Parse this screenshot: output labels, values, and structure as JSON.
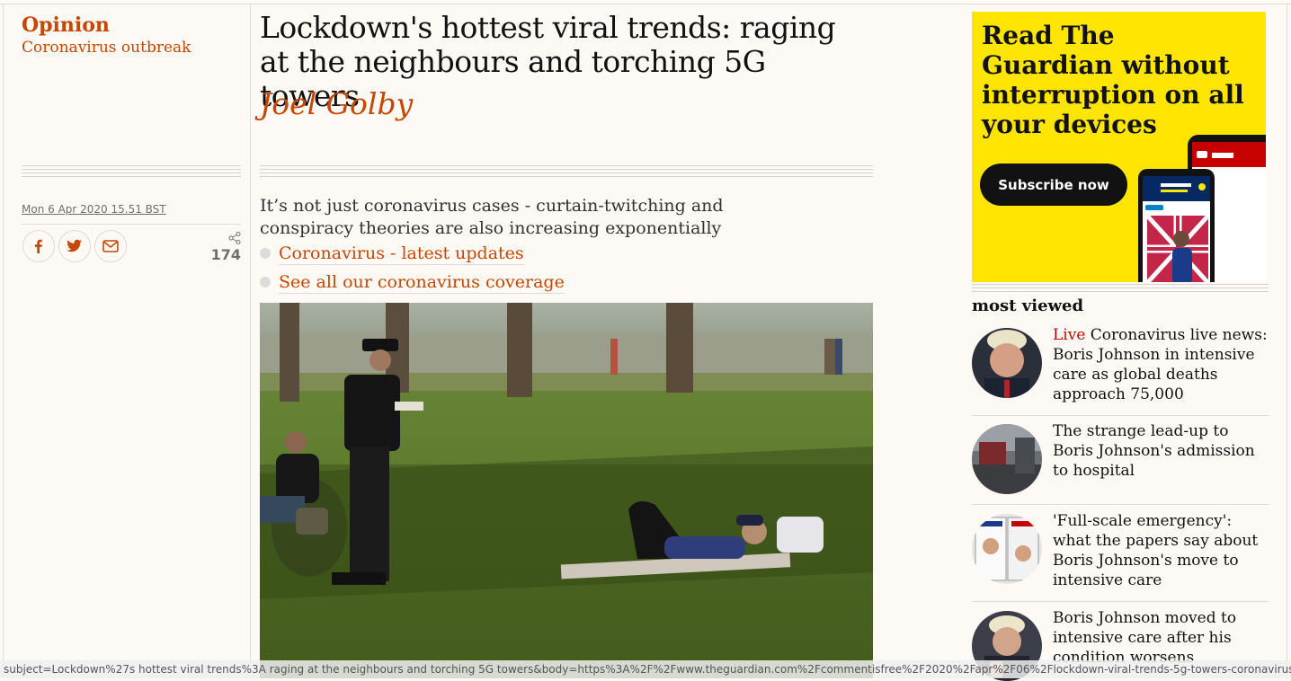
{
  "article": {
    "kicker": "Opinion",
    "series": "Coronavirus outbreak",
    "headline": "Lockdown's hottest viral trends: raging at the neighbours and torching 5G towers",
    "byline": "Joel Golby",
    "dateline": "Mon 6 Apr 2020 15.51 BST",
    "share_count": "174",
    "standfirst": "It’s not just coronavirus cases - curtain-twitching and conspiracy theories are also increasing exponentially",
    "related_links": [
      "Coronavirus - latest updates",
      "See all our coronavirus coverage"
    ]
  },
  "share_icons": [
    "facebook-icon",
    "twitter-icon",
    "email-icon",
    "share-icon"
  ],
  "ad": {
    "title": "Read The Guardian without interruption on all your devices",
    "button": "Subscribe now"
  },
  "most_viewed": {
    "heading": "most viewed",
    "items": [
      {
        "live": "Live",
        "text": "Coronavirus live news: Boris Johnson in intensive care as global deaths approach 75,000"
      },
      {
        "live": "",
        "text": "The strange lead-up to Boris Johnson's admission to hospital"
      },
      {
        "live": "",
        "text": "'Full-scale emergency': what the papers say about Boris Johnson's move to intensive care"
      },
      {
        "live": "",
        "text": "Boris Johnson moved to intensive care after his condition worsens"
      }
    ]
  },
  "status_bar": "subject=Lockdown%27s hottest viral trends%3A raging at the neighbours and torching 5G towers&body=https%3A%2F%2Fwww.theguardian.com%2Fcommentisfree%2F2020%2Fapr%2F06%2Flockdown-viral-trends-5g-towers-coronavirus",
  "colors": {
    "accent": "#c74600",
    "live": "#c70000",
    "ad_background": "#ffe500",
    "background": "#fdf9f5"
  }
}
